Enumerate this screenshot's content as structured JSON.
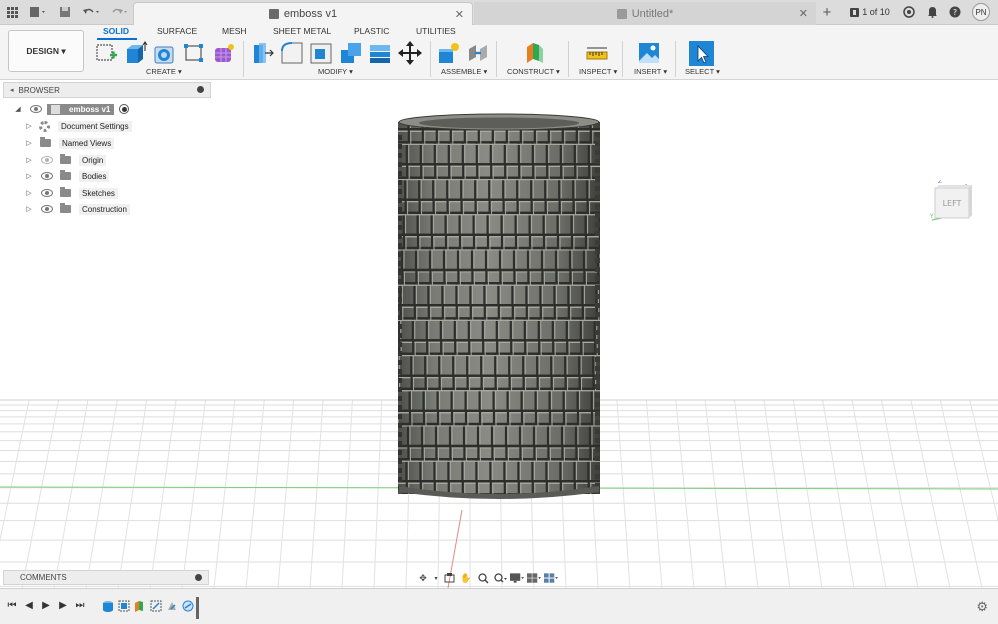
{
  "titlebar": {
    "tab_active": "emboss v1",
    "tab_inactive": "Untitled*",
    "close": "✕",
    "page_indicator": "1 of 10",
    "user_initials": "PN",
    "new_tab": "+"
  },
  "ribbon": {
    "workspace": "DESIGN ▾",
    "tabs": [
      "SOLID",
      "SURFACE",
      "MESH",
      "SHEET METAL",
      "PLASTIC",
      "UTILITIES"
    ],
    "groups": {
      "create": "CREATE ▾",
      "modify": "MODIFY ▾",
      "assemble": "ASSEMBLE ▾",
      "construct": "CONSTRUCT ▾",
      "inspect": "INSPECT ▾",
      "insert": "INSERT ▾",
      "select": "SELECT ▾"
    }
  },
  "browser": {
    "title": "BROWSER",
    "root": "emboss v1",
    "items": [
      "Document Settings",
      "Named Views",
      "Origin",
      "Bodies",
      "Sketches",
      "Construction"
    ]
  },
  "comments": {
    "title": "COMMENTS"
  },
  "viewcube": {
    "face": "LEFT",
    "axis_z": "Z",
    "axis_y": "Y"
  },
  "colors": {
    "accent": "#0b6fd3",
    "model": "#6e6f6a",
    "grid": "#d8d8d8"
  }
}
